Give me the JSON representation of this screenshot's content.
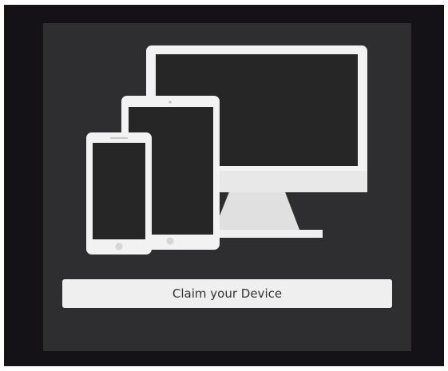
{
  "claim_button": {
    "label": "Claim your Device"
  },
  "illustration": {
    "icons": [
      "monitor-icon",
      "tablet-icon",
      "phone-icon"
    ]
  },
  "colors": {
    "page_background": "#141216",
    "panel_background": "#2e2d2f",
    "device_frame": "#f2f2f2",
    "device_screen": "#262626",
    "button_background": "#efefef",
    "button_text": "#333333"
  }
}
